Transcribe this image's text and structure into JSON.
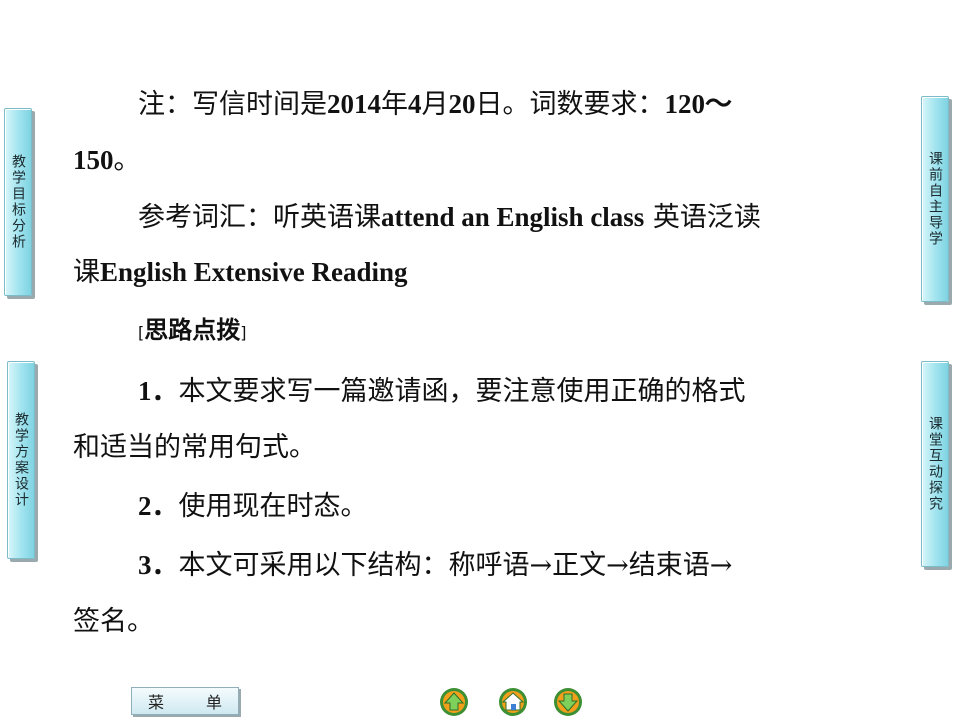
{
  "side_tabs": {
    "left_top": "教学目标分析",
    "left_bottom": "教学方案设计",
    "right_top": "课前自主导学",
    "right_bottom": "课堂互动探究"
  },
  "content": {
    "note_prefix": "注：写信时间是",
    "note_year": "2014",
    "note_year_unit": "年",
    "note_month": "4",
    "note_month_unit": "月",
    "note_day": "20",
    "note_day_unit": "日。词数要求：",
    "note_range_start": "120～",
    "note_range_end": "150",
    "note_end": "。",
    "vocab_prefix": "参考词汇：听英语课",
    "vocab_term1": "attend an English class",
    "vocab_mid": " 英语泛读",
    "vocab_line2_prefix": "课",
    "vocab_term2": "English Extensive Reading",
    "section_open": "[",
    "section_title": "思路点拨",
    "section_close": "]",
    "p1_num": "1．",
    "p1_line1": "本文要求写一篇邀请函，要注意使用正确的格式",
    "p1_line2": "和适当的常用句式。",
    "p2_num": "2．",
    "p2_text": "使用现在时态。",
    "p3_num": "3．",
    "p3_line1": "本文可采用以下结构：称呼语→正文→结束语→",
    "p3_line2": "签名。"
  },
  "bottom_bar": {
    "menu_left": "菜",
    "menu_right": "单",
    "icons": [
      "prev-arrow-icon",
      "home-icon",
      "next-arrow-icon"
    ]
  },
  "colors": {
    "tab_fill": "#9fe3ee",
    "tab_border": "#7cbcc8",
    "nav_orange": "#f2a01b",
    "nav_green": "#4aa83a"
  }
}
